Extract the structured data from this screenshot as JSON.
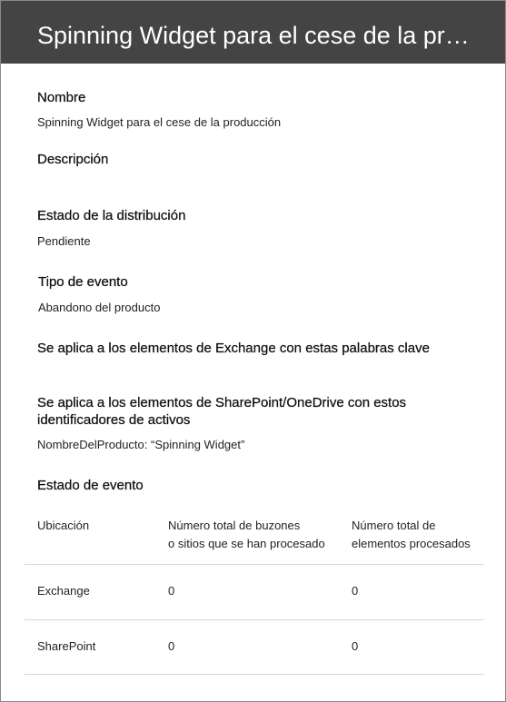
{
  "header": {
    "title": "Spinning Widget para el cese de la producción"
  },
  "fields": {
    "nombre_label": "Nombre",
    "nombre_value": "Spinning Widget para el cese de la producción",
    "descripcion_label": "Descripción",
    "estado_distribucion_label": "Estado de la distribución",
    "estado_distribucion_value": "Pendiente",
    "tipo_evento_label": "Tipo de evento",
    "tipo_evento_value": "Abandono del producto",
    "exchange_keywords_label": "Se aplica a los elementos de Exchange con estas palabras clave",
    "sharepoint_label_line1": "Se aplica a los elementos de SharePoint/OneDrive con estos",
    "sharepoint_label_line2": "identificadores de activos",
    "sharepoint_value": "NombreDelProducto: “Spinning Widget”",
    "estado_evento_label": "Estado de evento"
  },
  "table": {
    "headers": {
      "ubicacion": "Ubicación",
      "buzones_line1": "Número total de buzones",
      "buzones_line2": "o sitios que se han procesado",
      "elementos_line1": "Número total de",
      "elementos_line2": "elementos procesados"
    },
    "rows": [
      {
        "ubicacion": "Exchange",
        "buzones": "0",
        "elementos": "0"
      },
      {
        "ubicacion": "SharePoint",
        "buzones": "0",
        "elementos": "0"
      }
    ]
  }
}
